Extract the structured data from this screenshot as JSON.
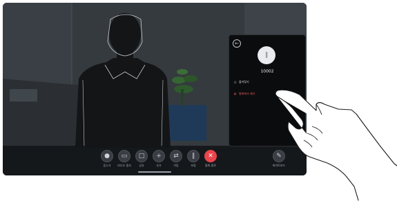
{
  "call_panel": {
    "caller_number": "10002",
    "menu": [
      {
        "icon": "star-icon",
        "label": "즐겨찾기"
      },
      {
        "icon": "close-icon",
        "label": "통화에서 제거"
      }
    ]
  },
  "toolbar": {
    "buttons": [
      {
        "icon": "microphone-icon",
        "label": "음소거"
      },
      {
        "icon": "video-camera-icon",
        "label": "비디오 중지"
      },
      {
        "icon": "share-screen-icon",
        "label": "공유"
      },
      {
        "icon": "plus-icon",
        "label": "추가"
      },
      {
        "icon": "transfer-icon",
        "label": "이동"
      },
      {
        "icon": "hold-icon",
        "label": "보류"
      },
      {
        "icon": "end-call-icon",
        "label": "통화 종료"
      },
      {
        "icon": "pencil-icon",
        "label": "화이트보드"
      }
    ]
  }
}
